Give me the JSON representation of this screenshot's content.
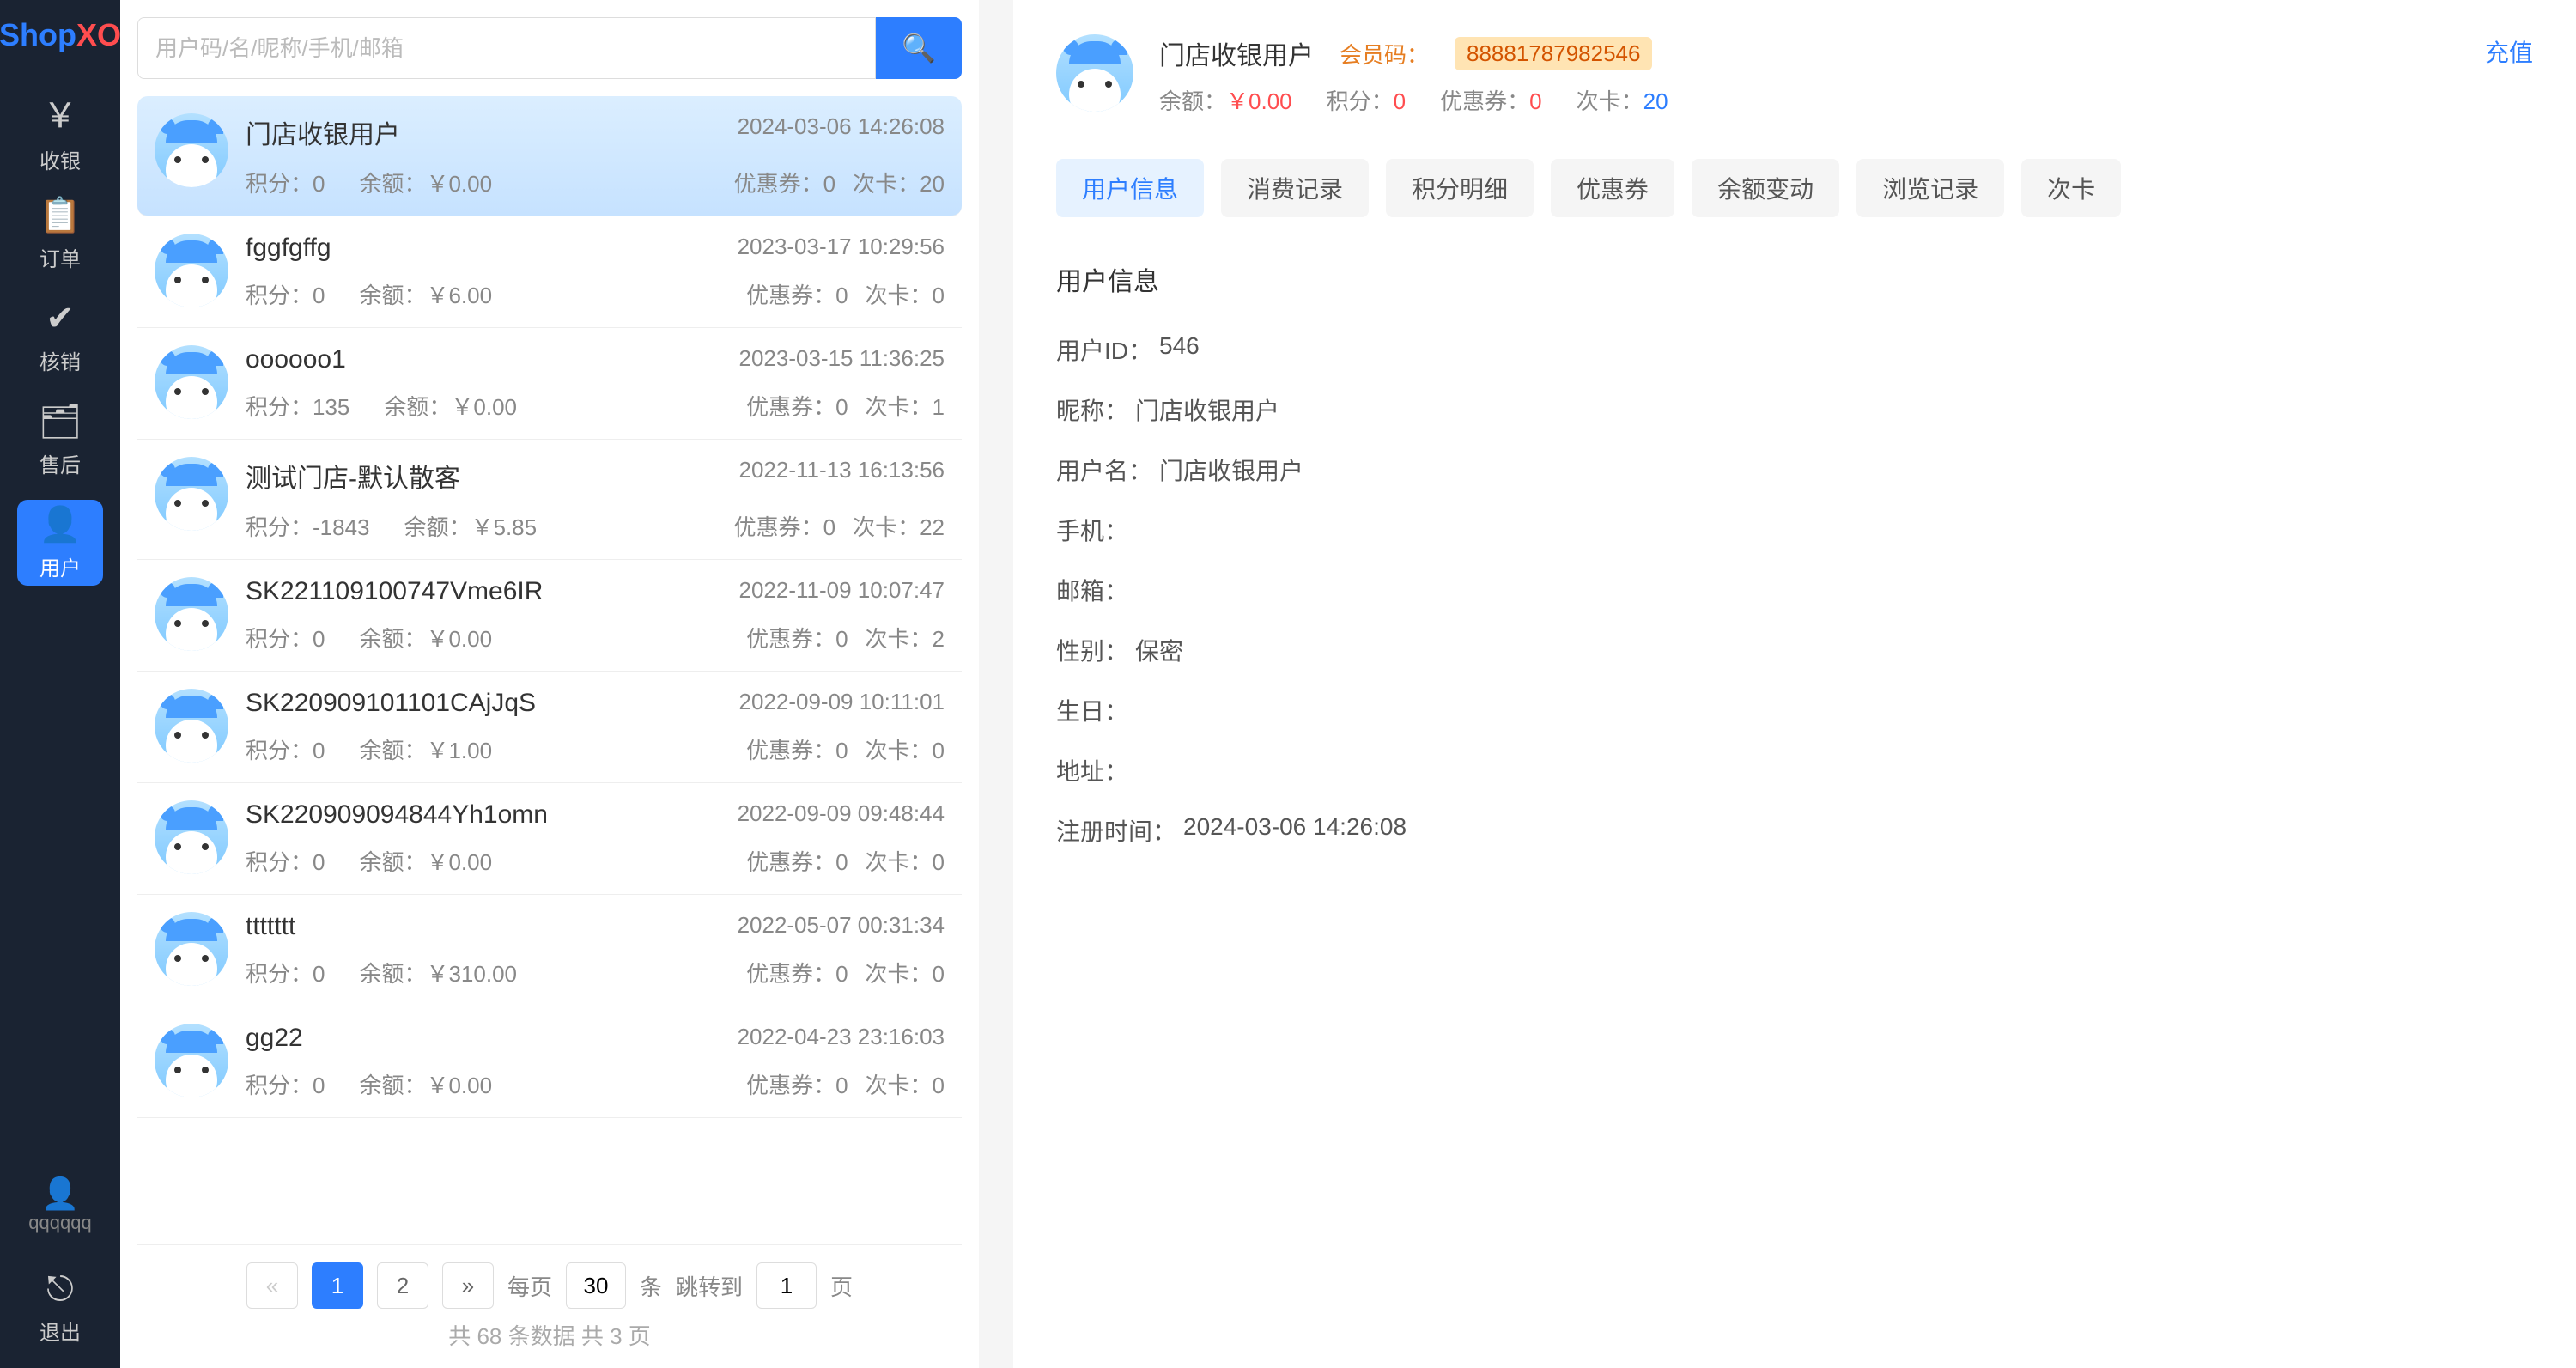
{
  "logo": {
    "shop": "Shop",
    "xo": "XO"
  },
  "sidebar": {
    "items": [
      {
        "icon": "cash",
        "label": "收银"
      },
      {
        "icon": "order",
        "label": "订单"
      },
      {
        "icon": "verify",
        "label": "核销"
      },
      {
        "icon": "after",
        "label": "售后"
      },
      {
        "icon": "user",
        "label": "用户"
      }
    ],
    "account": {
      "name": "qqqqqq"
    },
    "logout": "退出"
  },
  "search": {
    "placeholder": "用户码/名/昵称/手机/邮箱"
  },
  "users": [
    {
      "name": "门店收银用户",
      "date": "2024-03-06 14:26:08",
      "points": "0",
      "balance": "￥0.00",
      "coupons": "0",
      "cards": "20"
    },
    {
      "name": "fggfgffg",
      "date": "2023-03-17 10:29:56",
      "points": "0",
      "balance": "￥6.00",
      "coupons": "0",
      "cards": "0"
    },
    {
      "name": "oooooo1",
      "date": "2023-03-15 11:36:25",
      "points": "135",
      "balance": "￥0.00",
      "coupons": "0",
      "cards": "1"
    },
    {
      "name": "测试门店-默认散客",
      "date": "2022-11-13 16:13:56",
      "points": "-1843",
      "balance": "￥5.85",
      "coupons": "0",
      "cards": "22"
    },
    {
      "name": "SK221109100747Vme6IR",
      "date": "2022-11-09 10:07:47",
      "points": "0",
      "balance": "￥0.00",
      "coupons": "0",
      "cards": "2"
    },
    {
      "name": "SK220909101101CAjJqS",
      "date": "2022-09-09 10:11:01",
      "points": "0",
      "balance": "￥1.00",
      "coupons": "0",
      "cards": "0"
    },
    {
      "name": "SK220909094844Yh1omn",
      "date": "2022-09-09 09:48:44",
      "points": "0",
      "balance": "￥0.00",
      "coupons": "0",
      "cards": "0"
    },
    {
      "name": "ttttttt",
      "date": "2022-05-07 00:31:34",
      "points": "0",
      "balance": "￥310.00",
      "coupons": "0",
      "cards": "0"
    },
    {
      "name": "gg22",
      "date": "2022-04-23 23:16:03",
      "points": "0",
      "balance": "￥0.00",
      "coupons": "0",
      "cards": "0"
    }
  ],
  "list_labels": {
    "points": "积分：",
    "balance": "余额：",
    "coupons": "优惠券：",
    "cards": "次卡："
  },
  "pagination": {
    "prev": "«",
    "next": "»",
    "p1": "1",
    "p2": "2",
    "per_page_label": "每页",
    "per_page_value": "30",
    "per_page_unit": "条",
    "jump_label": "跳转到",
    "jump_value": "1",
    "jump_unit": "页",
    "summary": "共 68 条数据  共 3 页"
  },
  "detail": {
    "name": "门店收银用户",
    "member_code_label": "会员码：",
    "member_code": "88881787982546",
    "balance_label": "余额：",
    "balance": "￥0.00",
    "points_label": "积分：",
    "points": "0",
    "coupons_label": "优惠券：",
    "coupons": "0",
    "cards_label": "次卡：",
    "cards": "20",
    "recharge": "充值"
  },
  "tabs": [
    "用户信息",
    "消费记录",
    "积分明细",
    "优惠券",
    "余额变动",
    "浏览记录",
    "次卡"
  ],
  "info_section": {
    "title": "用户信息",
    "rows": [
      {
        "label": "用户ID：",
        "value": "546"
      },
      {
        "label": "昵称：",
        "value": "门店收银用户"
      },
      {
        "label": "用户名：",
        "value": "门店收银用户"
      },
      {
        "label": "手机：",
        "value": ""
      },
      {
        "label": "邮箱：",
        "value": ""
      },
      {
        "label": "性别：",
        "value": "保密"
      },
      {
        "label": "生日：",
        "value": ""
      },
      {
        "label": "地址：",
        "value": ""
      },
      {
        "label": "注册时间：",
        "value": "2024-03-06 14:26:08"
      }
    ]
  }
}
